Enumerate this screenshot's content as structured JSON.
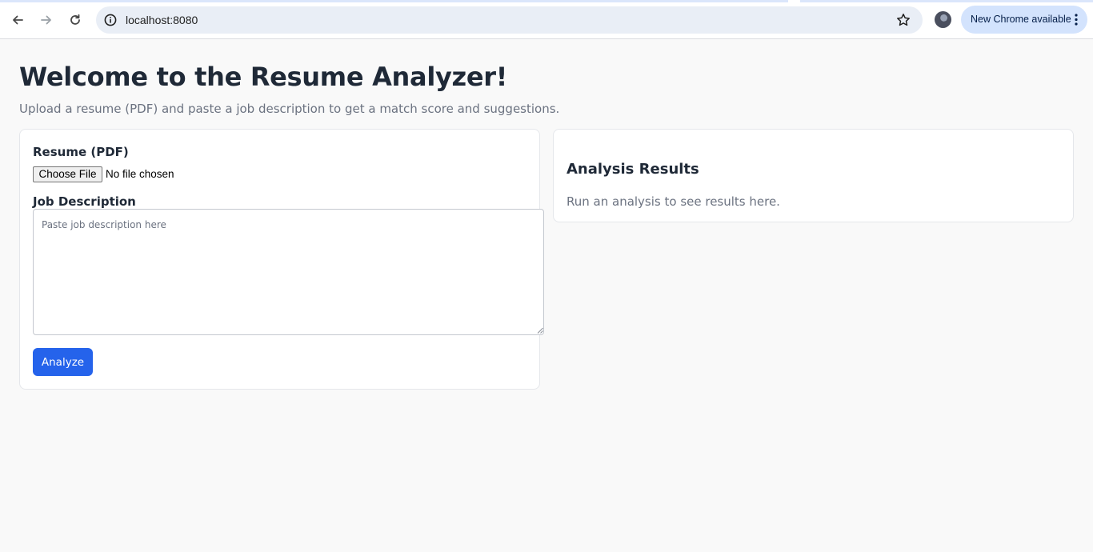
{
  "browser": {
    "url": "localhost:8080",
    "update_label": "New Chrome available",
    "icons": {
      "back": "arrow-back-icon",
      "forward": "arrow-forward-icon",
      "reload": "reload-icon",
      "site_info": "info-icon",
      "bookmark": "star-icon",
      "menu": "kebab-menu-icon"
    }
  },
  "page": {
    "title": "Welcome to the Resume Analyzer!",
    "subtitle": "Upload a resume (PDF) and paste a job description to get a match score and suggestions."
  },
  "form": {
    "resume_label": "Resume (PDF)",
    "file_button_label": "Choose File",
    "file_status": "No file chosen",
    "job_label": "Job Description",
    "job_value": "",
    "job_placeholder": "Paste job description here",
    "analyze_label": "Analyze"
  },
  "results": {
    "title": "Analysis Results",
    "empty_message": "Run an analysis to see results here."
  },
  "colors": {
    "accent": "#2563eb",
    "page_background": "#f9f9f9",
    "muted_text": "#6b7280",
    "heading_text": "#1f2937"
  }
}
